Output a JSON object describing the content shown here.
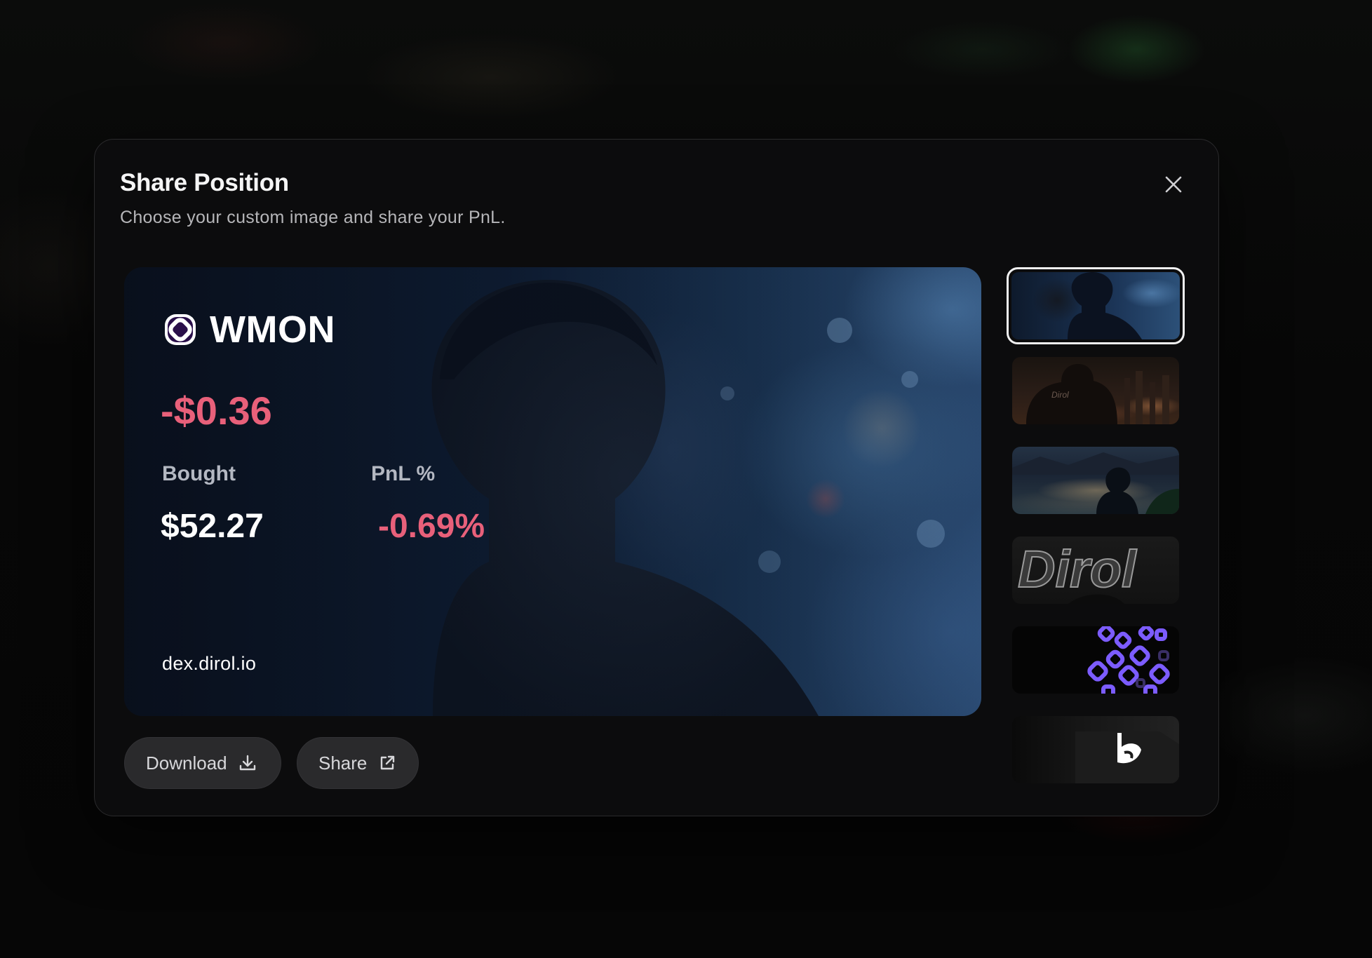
{
  "modal": {
    "title": "Share Position",
    "subtitle": "Choose your custom image and share your PnL."
  },
  "card": {
    "token": "WMON",
    "pnl_usd": "-$0.36",
    "bought_label": "Bought",
    "bought_value": "$52.27",
    "pnl_pct_label": "PnL %",
    "pnl_pct_value": "-0.69%",
    "site": "dex.dirol.io",
    "thumb4_text": "Dirol",
    "thumb2_text": "Dirol"
  },
  "actions": {
    "download_label": "Download",
    "share_label": "Share"
  },
  "thumbnails": {
    "selected_index": 0,
    "count": 6
  },
  "colors": {
    "negative": "#e8607a",
    "accent_purple": "#7c5cff",
    "modal_bg": "#0c0c0d"
  }
}
